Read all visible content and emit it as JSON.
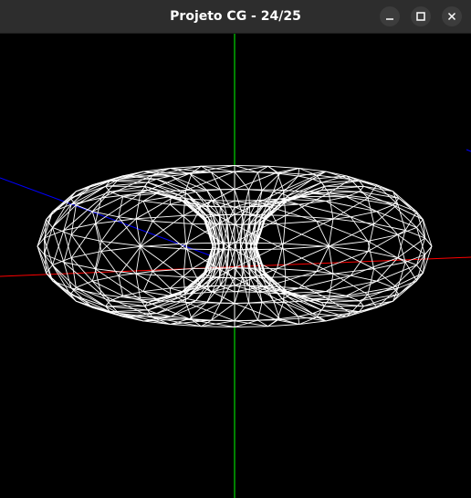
{
  "window": {
    "title": "Projeto CG - 24/25",
    "controls": [
      "minimize-icon",
      "maximize-icon",
      "close-icon"
    ]
  },
  "scene": {
    "background": "#000000",
    "wireframe_color": "#ffffff",
    "axes": {
      "x_color": "#ff0000",
      "y_color": "#00ff00",
      "z_color": "#0000ff"
    },
    "model": "torus"
  }
}
